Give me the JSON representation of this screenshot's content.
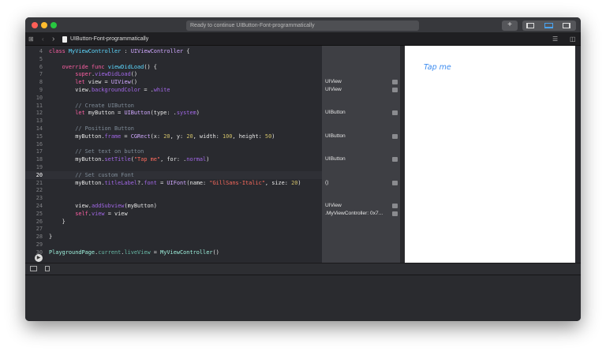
{
  "window": {
    "status": "Ready to continue UIButton-Font-programmatically",
    "add_label": "+",
    "colors": {
      "close": "#fe5f57",
      "minimize": "#febc2e",
      "zoom": "#28c840"
    }
  },
  "nav": {
    "file_name": "UIButton-Font-programmatically"
  },
  "code": {
    "current_line": 20,
    "lines": [
      {
        "n": "4",
        "t": [
          [
            "class ",
            "kw"
          ],
          [
            "MyViewController",
            "cl"
          ],
          [
            " : ",
            ""
          ],
          [
            "UIViewController",
            "ty"
          ],
          [
            " {",
            ""
          ]
        ]
      },
      {
        "n": "5",
        "t": []
      },
      {
        "n": "6",
        "t": [
          [
            "    override func ",
            "kw"
          ],
          [
            "viewDidLoad",
            "cl"
          ],
          [
            "() {",
            ""
          ]
        ]
      },
      {
        "n": "7",
        "t": [
          [
            "        super",
            "kw"
          ],
          [
            ".",
            ""
          ],
          [
            "viewDidLoad",
            "fn"
          ],
          [
            "()",
            ""
          ]
        ]
      },
      {
        "n": "8",
        "t": [
          [
            "        let ",
            "kw"
          ],
          [
            "view = ",
            ""
          ],
          [
            "UIView",
            "ty"
          ],
          [
            "()",
            ""
          ]
        ]
      },
      {
        "n": "9",
        "t": [
          [
            "        view.",
            ""
          ],
          [
            "backgroundColor",
            "fn"
          ],
          [
            " = .",
            ""
          ],
          [
            "white",
            "fn"
          ]
        ]
      },
      {
        "n": "10",
        "t": []
      },
      {
        "n": "11",
        "t": [
          [
            "        // Create UIButton",
            "cm"
          ]
        ]
      },
      {
        "n": "12",
        "t": [
          [
            "        let ",
            "kw"
          ],
          [
            "myButton = ",
            ""
          ],
          [
            "UIButton",
            "ty"
          ],
          [
            "(type: .",
            ""
          ],
          [
            "system",
            "fn"
          ],
          [
            ")",
            ""
          ]
        ]
      },
      {
        "n": "13",
        "t": []
      },
      {
        "n": "14",
        "t": [
          [
            "        // Position Button",
            "cm"
          ]
        ]
      },
      {
        "n": "15",
        "t": [
          [
            "        myButton.",
            ""
          ],
          [
            "frame",
            "fn"
          ],
          [
            " = ",
            ""
          ],
          [
            "CGRect",
            "ty"
          ],
          [
            "(x: ",
            ""
          ],
          [
            "20",
            "nu"
          ],
          [
            ", y: ",
            ""
          ],
          [
            "20",
            "nu"
          ],
          [
            ", width: ",
            ""
          ],
          [
            "100",
            "nu"
          ],
          [
            ", height: ",
            ""
          ],
          [
            "50",
            "nu"
          ],
          [
            ")",
            ""
          ]
        ]
      },
      {
        "n": "16",
        "t": []
      },
      {
        "n": "17",
        "t": [
          [
            "        // Set text on button",
            "cm"
          ]
        ]
      },
      {
        "n": "18",
        "t": [
          [
            "        myButton.",
            ""
          ],
          [
            "setTitle",
            "fn"
          ],
          [
            "(",
            ""
          ],
          [
            "\"Tap me\"",
            "st"
          ],
          [
            ", for: .",
            ""
          ],
          [
            "normal",
            "fn"
          ],
          [
            ")",
            ""
          ]
        ]
      },
      {
        "n": "19",
        "t": []
      },
      {
        "n": "20",
        "t": [
          [
            "        // Set custom Font",
            "cm"
          ]
        ]
      },
      {
        "n": "21",
        "t": [
          [
            "        myButton.",
            ""
          ],
          [
            "titleLabel",
            "fn"
          ],
          [
            "?.",
            ""
          ],
          [
            "font",
            "fn"
          ],
          [
            " = ",
            ""
          ],
          [
            "UIFont",
            "ty"
          ],
          [
            "(name: ",
            ""
          ],
          [
            "\"GillSans-Italic\"",
            "st"
          ],
          [
            ", size: ",
            ""
          ],
          [
            "20",
            "nu"
          ],
          [
            ")",
            ""
          ]
        ]
      },
      {
        "n": "22",
        "t": []
      },
      {
        "n": "23",
        "t": []
      },
      {
        "n": "24",
        "t": [
          [
            "        view.",
            ""
          ],
          [
            "addSubview",
            "fn"
          ],
          [
            "(myButton)",
            ""
          ]
        ]
      },
      {
        "n": "25",
        "t": [
          [
            "        self",
            "kw"
          ],
          [
            ".",
            ""
          ],
          [
            "view",
            "fn"
          ],
          [
            " = view",
            ""
          ]
        ]
      },
      {
        "n": "26",
        "t": [
          [
            "    }",
            ""
          ]
        ]
      },
      {
        "n": "27",
        "t": []
      },
      {
        "n": "28",
        "t": [
          [
            "}",
            ""
          ]
        ]
      },
      {
        "n": "29",
        "t": []
      },
      {
        "n": "30",
        "t": [
          [
            "PlaygroundPage",
            "pg"
          ],
          [
            ".",
            ""
          ],
          [
            "current",
            "nm"
          ],
          [
            ".",
            ""
          ],
          [
            "liveView",
            "nm"
          ],
          [
            " = ",
            ""
          ],
          [
            "MyViewController",
            "pg"
          ],
          [
            "()",
            ""
          ]
        ]
      }
    ]
  },
  "results": [
    {
      "line": "8",
      "text": "UIView"
    },
    {
      "line": "9",
      "text": "UIView"
    },
    {
      "line": "12",
      "text": "UIButton"
    },
    {
      "line": "15",
      "text": "UIButton"
    },
    {
      "line": "18",
      "text": "UIButton"
    },
    {
      "line": "21",
      "text": "()"
    },
    {
      "line": "24",
      "text": "UIView"
    },
    {
      "line": "25",
      "text": ".MyViewController: 0x7..."
    }
  ],
  "live_view": {
    "button_title": "Tap me"
  }
}
